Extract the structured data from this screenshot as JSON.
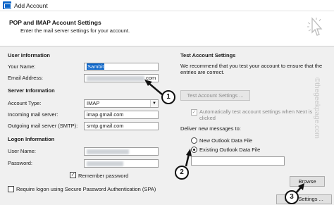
{
  "window": {
    "title": "Add Account",
    "icon": "outlook-icon"
  },
  "header": {
    "title": "POP and IMAP Account Settings",
    "subtitle": "Enter the mail server settings for your account."
  },
  "user_info": {
    "heading": "User Information",
    "name_label": "Your Name:",
    "name_value": "Sambit",
    "email_label": "Email Address:",
    "email_suffix": ".com"
  },
  "server_info": {
    "heading": "Server Information",
    "account_type_label": "Account Type:",
    "account_type_value": "IMAP",
    "incoming_label": "Incoming mail server:",
    "incoming_value": "imap.gmail.com",
    "outgoing_label": "Outgoing mail server (SMTP):",
    "outgoing_value": "smtp.gmail.com"
  },
  "logon_info": {
    "heading": "Logon Information",
    "username_label": "User Name:",
    "password_label": "Password:",
    "remember_label": "Remember password",
    "remember_checked": true,
    "spa_label": "Require logon using Secure Password Authentication (SPA)",
    "spa_checked": false
  },
  "test_settings": {
    "heading": "Test Account Settings",
    "description": "We recommend that you test your account to ensure that the entries are correct.",
    "test_button": "Test Account Settings ...",
    "auto_test_label": "Automatically test account settings when Next is clicked",
    "auto_test_checked": true
  },
  "deliver": {
    "heading": "Deliver new messages to:",
    "options": [
      "New Outlook Data File",
      "Existing Outlook Data File"
    ],
    "selected_index": 1,
    "browse_button": "Browse",
    "path_value": ""
  },
  "footer": {
    "more_settings_button": "More Settings ..."
  },
  "annotations": [
    "1",
    "2",
    "3"
  ],
  "watermark": "©thegeekpage.com",
  "colors": {
    "selection": "#0a64c8",
    "background": "#f0f0f0"
  }
}
